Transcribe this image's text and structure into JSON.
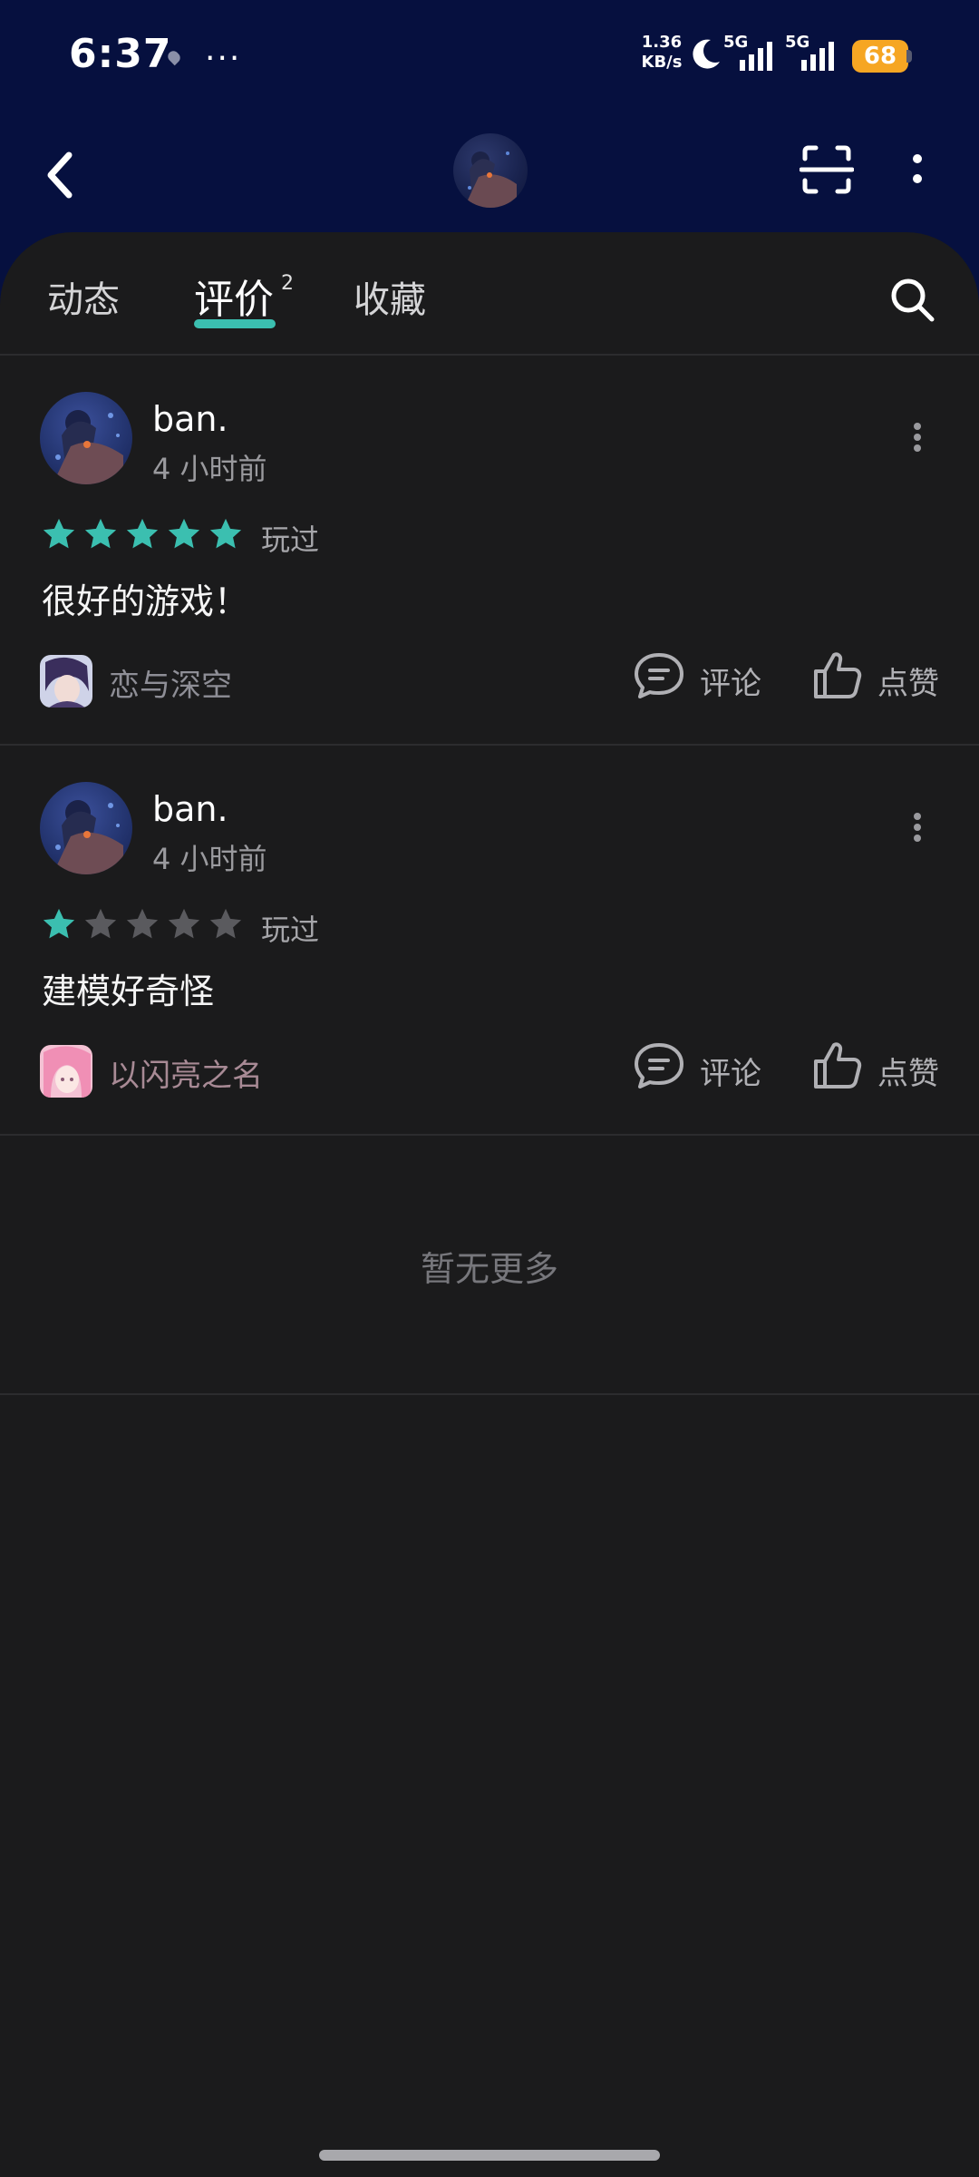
{
  "status_bar": {
    "time": "6:37",
    "net_speed_value": "1.36",
    "net_speed_unit": "KB/s",
    "signal_1": "5G",
    "signal_2": "5G",
    "battery": "68",
    "battery_color": "#f6a623"
  },
  "nav": {
    "back_icon": "chevron-left-icon",
    "scan_icon": "scan-icon",
    "more_icon": "more-vertical-icon"
  },
  "tabs": {
    "items": [
      {
        "label": "动态"
      },
      {
        "label": "评价",
        "badge": "2",
        "active": true
      },
      {
        "label": "收藏"
      }
    ],
    "accent_color": "#3bbfb0",
    "search_icon": "search-icon"
  },
  "reviews": [
    {
      "user": "ban.",
      "time": "4 小时前",
      "rating": 5,
      "rating_max": 5,
      "status": "玩过",
      "text": "很好的游戏！",
      "game": "恋与深空",
      "comment_label": "评论",
      "like_label": "点赞"
    },
    {
      "user": "ban.",
      "time": "4 小时前",
      "rating": 1,
      "rating_max": 5,
      "status": "玩过",
      "text": "建模好奇怪",
      "game": "以闪亮之名",
      "comment_label": "评论",
      "like_label": "点赞"
    }
  ],
  "footer": {
    "no_more": "暂无更多"
  }
}
